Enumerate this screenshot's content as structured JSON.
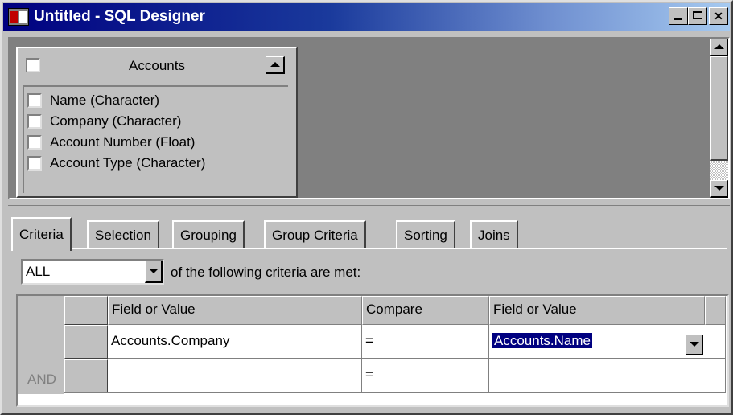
{
  "window": {
    "title": "Untitled - SQL Designer"
  },
  "table_box": {
    "title": "Accounts",
    "fields": [
      "Name (Character)",
      "Company (Character)",
      "Account Number (Float)",
      "Account Type (Character)"
    ]
  },
  "tabs": [
    {
      "label": "Criteria",
      "active": true
    },
    {
      "label": "Selection",
      "active": false
    },
    {
      "label": "Grouping",
      "active": false
    },
    {
      "label": "Group Criteria",
      "active": false
    },
    {
      "label": "Sorting",
      "active": false
    },
    {
      "label": "Joins",
      "active": false
    }
  ],
  "criteria": {
    "match_mode": "ALL",
    "match_text": "of the following criteria are met:",
    "columns": [
      "Field or Value",
      "Compare",
      "Field or Value"
    ],
    "rows": [
      {
        "connector": "",
        "field": "Accounts.Company",
        "compare": "=",
        "value": "Accounts.Name"
      },
      {
        "connector": "AND",
        "field": "",
        "compare": "=",
        "value": ""
      }
    ]
  },
  "colors": {
    "title_bar_start": "#000080",
    "title_bar_end": "#a6caf0",
    "face": "#c0c0c0",
    "selection": "#000080"
  }
}
